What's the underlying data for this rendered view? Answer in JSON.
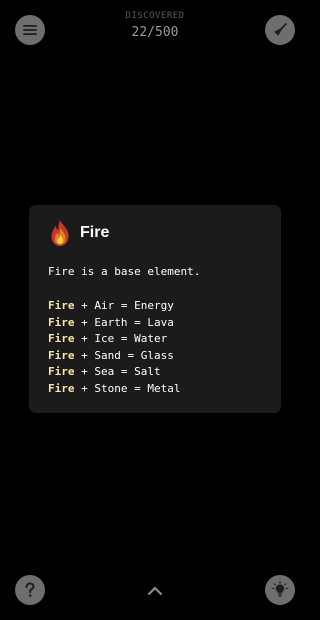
{
  "header": {
    "counter_label": "DISCOVERED",
    "counter_value": "22/500",
    "menu_icon": "hamburger-menu-icon",
    "clean_icon": "broom-icon"
  },
  "element_card": {
    "icon": "fire-icon",
    "title": "Fire",
    "description": "Fire is a base element.",
    "recipes": [
      {
        "first": "Fire",
        "second": "Air",
        "result": "Energy"
      },
      {
        "first": "Fire",
        "second": "Earth",
        "result": "Lava"
      },
      {
        "first": "Fire",
        "second": "Ice",
        "result": "Water"
      },
      {
        "first": "Fire",
        "second": "Sand",
        "result": "Glass"
      },
      {
        "first": "Fire",
        "second": "Sea",
        "result": "Salt"
      },
      {
        "first": "Fire",
        "second": "Stone",
        "result": "Metal"
      }
    ]
  },
  "footer": {
    "help_icon": "question-mark-icon",
    "expand_icon": "chevron-up-icon",
    "hint_icon": "lightbulb-icon"
  },
  "colors": {
    "background": "#000000",
    "card": "#1b1b1b",
    "button": "#6e6e6e",
    "highlight": "#f3e6a6"
  }
}
